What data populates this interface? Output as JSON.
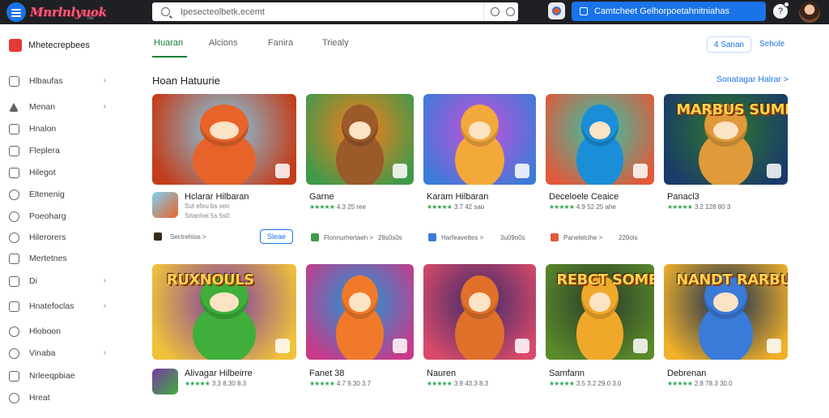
{
  "app": {
    "logo_text": "Mnrlnlyuok",
    "logo_sub": "nkl"
  },
  "search": {
    "value": "Ipesecteolbetk.ecemt"
  },
  "header": {
    "action_button": "Camtcheet Gelhorpoetahnitniahas"
  },
  "sidebar": {
    "title": "Mhetecrepbees",
    "items": [
      {
        "label": "Hlbaufas",
        "has_chevron": true
      },
      {
        "label": "Menan",
        "has_chevron": true
      },
      {
        "label": "Hnalon",
        "has_chevron": false
      },
      {
        "label": "Fleplera",
        "has_chevron": false
      },
      {
        "label": "Hilegot",
        "has_chevron": false
      },
      {
        "label": "Eltenenig",
        "has_chevron": false
      },
      {
        "label": "Poeoharg",
        "has_chevron": false
      },
      {
        "label": "Hilerorers",
        "has_chevron": false
      },
      {
        "label": "Mertetnes",
        "has_chevron": false
      },
      {
        "label": "Di",
        "has_chevron": true
      },
      {
        "label": "Hnatefoclas",
        "has_chevron": true
      },
      {
        "label": "Hloboon",
        "has_chevron": false
      },
      {
        "label": "Vinaba",
        "has_chevron": true
      },
      {
        "label": "Nrleeqpbiae",
        "has_chevron": false
      },
      {
        "label": "Hreat",
        "has_chevron": false
      }
    ]
  },
  "tabs": [
    {
      "label": "Huaran"
    },
    {
      "label": "Alcions"
    },
    {
      "label": "Fanira"
    },
    {
      "label": "Triealy"
    }
  ],
  "filters": {
    "chip": "4 Sanan",
    "right": "Sehole"
  },
  "section": {
    "title": "Hoan Hatuurie",
    "see_more": "Sonatagar Halrar >"
  },
  "row1": [
    {
      "title": "Hclarar Hilbaran",
      "sub": "Sut efeu bs sen",
      "meta": "Srtanhei 5s  5s0",
      "dev": "Sectrehios >",
      "install": "Sleae",
      "colors": [
        "#7fd0f0",
        "#e8632a",
        "#c33d1a"
      ]
    },
    {
      "title": "Garne",
      "rating": "4.3  25 ree",
      "meta": "Flonnurhertaeh >",
      "size": "28s0s0s",
      "colors": [
        "#ff7a1a",
        "#9a5a2a",
        "#3f9a4a"
      ]
    },
    {
      "title": "Karam Hilbaran",
      "rating": "3.7  42 sao",
      "meta": "Harfeavettes >",
      "size": "3u09o0s",
      "colors": [
        "#c84fd8",
        "#f2a93a",
        "#3d7bd8"
      ]
    },
    {
      "title": "Deceloele Ceaice",
      "rating": "4.9  52 25 ahe",
      "meta": "Panelelcihe >",
      "size": "220ols",
      "colors": [
        "#2fc7ae",
        "#1a8fd8",
        "#e05a3a"
      ]
    },
    {
      "title": "Panacl3",
      "rating": "3.2  128 80  3",
      "meta": "",
      "size": "",
      "colors": [
        "#2f7a2a",
        "#e09a3a",
        "#1a3a6a"
      ]
    }
  ],
  "row1_art": [
    "",
    "",
    "",
    "",
    "MARBUS SUMES"
  ],
  "row2": [
    {
      "title": "Alivagar Hilbeirre",
      "rating": "3.3  8.30 8.3",
      "art": "RUXNOULS",
      "colors": [
        "#7a3aa8",
        "#3fae3a",
        "#f0c23a"
      ]
    },
    {
      "title": "Fanet 38",
      "rating": "4.7  9.30 3.7",
      "art": "",
      "colors": [
        "#1a9ad8",
        "#f07a2a",
        "#c83a8a"
      ]
    },
    {
      "title": "Nauren",
      "rating": "3.9  43.3 8.3",
      "art": "",
      "colors": [
        "#3a2a6a",
        "#e0702a",
        "#d84a6a"
      ]
    },
    {
      "title": "Samfann",
      "rating": "3.5  3.2 29.0 3.0",
      "art": "REBCT SOMES",
      "colors": [
        "#2a3a2a",
        "#f0a82a",
        "#5a8a2a"
      ]
    },
    {
      "title": "Debrenan",
      "rating": "2.8  78.3 30.0",
      "art": "NANDT RARBUS",
      "colors": [
        "#0f2a55",
        "#3a7ad8",
        "#f0b02a"
      ]
    }
  ]
}
